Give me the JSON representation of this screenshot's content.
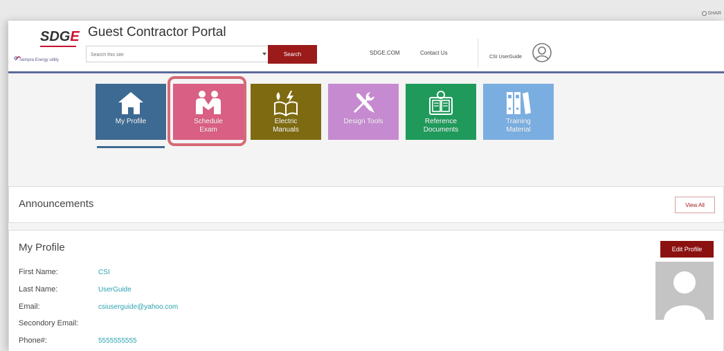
{
  "topbar": {
    "share_label": "SHAR"
  },
  "header": {
    "logo_text_a": "SDG",
    "logo_text_b": "E",
    "logo_sub": "Sempra Energy utility",
    "portal_title": "Guest Contractor Portal",
    "search_placeholder": "Search this site",
    "search_button": "Search",
    "link_sdge": "SDGE.COM",
    "link_contact": "Contact Us",
    "username": "CSI UserGuide"
  },
  "tiles": [
    {
      "line1": "My Profile",
      "line2": "",
      "color": "#3d6a92",
      "icon": "house-icon"
    },
    {
      "line1": "Schedule",
      "line2": "Exam",
      "color": "#d95f84",
      "icon": "people-icon"
    },
    {
      "line1": "Electric",
      "line2": "Manuals",
      "color": "#7e6a10",
      "icon": "electric-manual-icon"
    },
    {
      "line1": "Design Tools",
      "line2": "",
      "color": "#c68ad0",
      "icon": "tools-icon"
    },
    {
      "line1": "Reference",
      "line2": "Documents",
      "color": "#1f9a5a",
      "icon": "reference-docs-icon"
    },
    {
      "line1": "Training",
      "line2": "Material",
      "color": "#7baee0",
      "icon": "binders-icon"
    }
  ],
  "announcements": {
    "title": "Announcements",
    "view_all": "View All"
  },
  "profile": {
    "title": "My Profile",
    "edit_button": "Edit Profile",
    "fields": [
      {
        "label": "First Name:",
        "value": "CSI"
      },
      {
        "label": "Last Name:",
        "value": "UserGuide"
      },
      {
        "label": "Email:",
        "value": "csiuserguide@yahoo.com"
      },
      {
        "label": "Secondory Email:",
        "value": ""
      },
      {
        "label": "Phone#:",
        "value": "5555555555"
      }
    ]
  }
}
